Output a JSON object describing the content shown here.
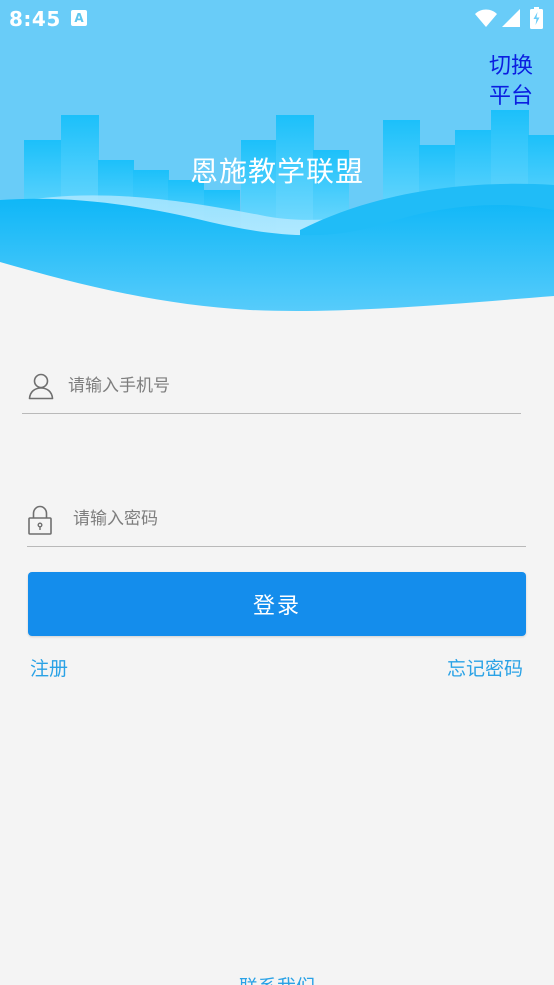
{
  "status_bar": {
    "time": "8:45",
    "notification_icon": "A"
  },
  "header": {
    "switch_platform_line1": "切换",
    "switch_platform_line2": "平台",
    "title": "恩施教学联盟"
  },
  "form": {
    "phone_placeholder": "请输入手机号",
    "password_placeholder": "请输入密码",
    "login_label": "登录",
    "register_label": "注册",
    "forgot_password_label": "忘记密码"
  },
  "footer": {
    "contact_label": "联系我们"
  },
  "colors": {
    "header_sky": "#6bcdf9",
    "wave_main": "#14b9f7",
    "primary_button": "#148dec",
    "link": "#2aa2e6",
    "switch_platform_text": "#0b1ee0",
    "background": "#f4f4f4"
  }
}
